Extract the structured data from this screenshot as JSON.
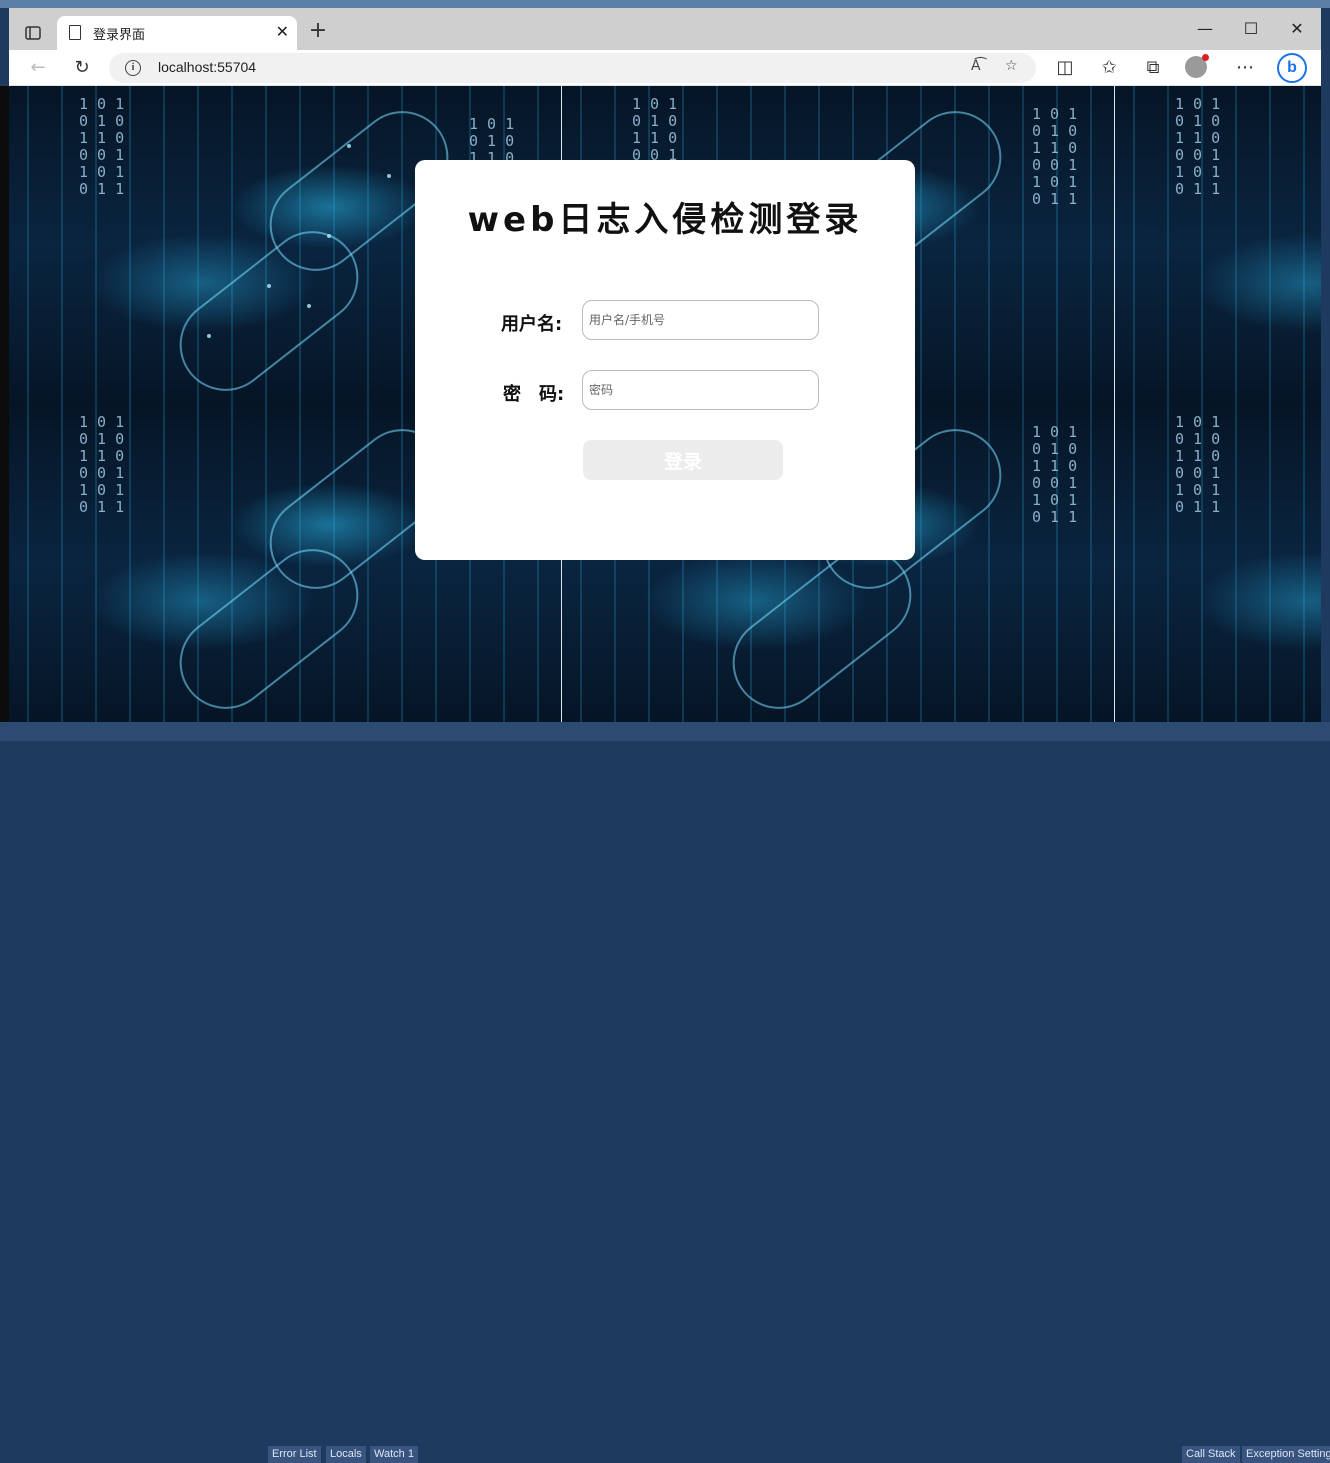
{
  "browser": {
    "tab_title": "登录界面",
    "new_tab": "+",
    "url": "localhost:55704",
    "minimize": "—",
    "maximize": "☐",
    "close": "✕"
  },
  "login": {
    "title": "web日志入侵检测登录",
    "username_label": "用户名:",
    "username_placeholder": "用户名/手机号",
    "password_label": "密　码:",
    "password_placeholder": "密码",
    "submit_label": "登录"
  },
  "background_binary": "1 0 1\n0 1 0\n1 1 0\n0 0 1\n1 0 1\n0 1 1",
  "desktop_panels": [
    "Error List",
    "Locals",
    "Watch 1",
    "Call Stack",
    "Exception Settings"
  ]
}
